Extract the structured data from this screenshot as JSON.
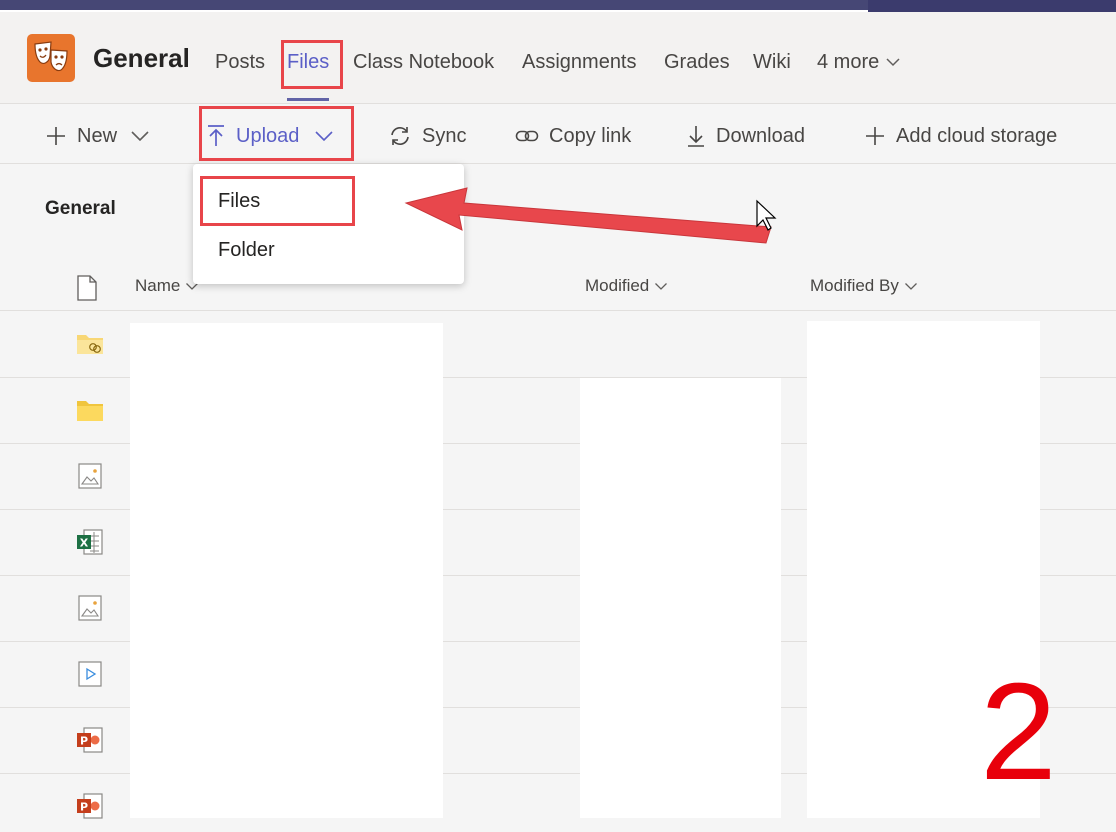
{
  "header": {
    "channel_title": "General",
    "tabs": [
      {
        "label": "Posts",
        "active": false
      },
      {
        "label": "Files",
        "active": true
      },
      {
        "label": "Class Notebook",
        "active": false
      },
      {
        "label": "Assignments",
        "active": false
      },
      {
        "label": "Grades",
        "active": false
      },
      {
        "label": "Wiki",
        "active": false
      },
      {
        "label": "4 more",
        "active": false
      }
    ]
  },
  "toolbar": {
    "new_label": "New",
    "upload_label": "Upload",
    "sync_label": "Sync",
    "copy_link_label": "Copy link",
    "download_label": "Download",
    "add_cloud_storage_label": "Add cloud storage"
  },
  "upload_menu": {
    "items": [
      {
        "label": "Files"
      },
      {
        "label": "Folder"
      }
    ]
  },
  "breadcrumb": "General",
  "columns": {
    "name": "Name",
    "modified": "Modified",
    "modified_by": "Modified By"
  },
  "file_rows": [
    {
      "icon": "shared-folder-icon"
    },
    {
      "icon": "folder-icon"
    },
    {
      "icon": "image-file-icon"
    },
    {
      "icon": "excel-file-icon"
    },
    {
      "icon": "image-file-icon"
    },
    {
      "icon": "video-file-icon"
    },
    {
      "icon": "powerpoint-file-icon"
    },
    {
      "icon": "powerpoint-file-icon"
    }
  ],
  "annotation": {
    "step_number": "2",
    "highlight_color": "#e8454a",
    "arrow_color": "#e8474c"
  },
  "colors": {
    "accent": "#5b5fc7",
    "team_logo": "#e8752d",
    "top_bar": "#464775"
  }
}
